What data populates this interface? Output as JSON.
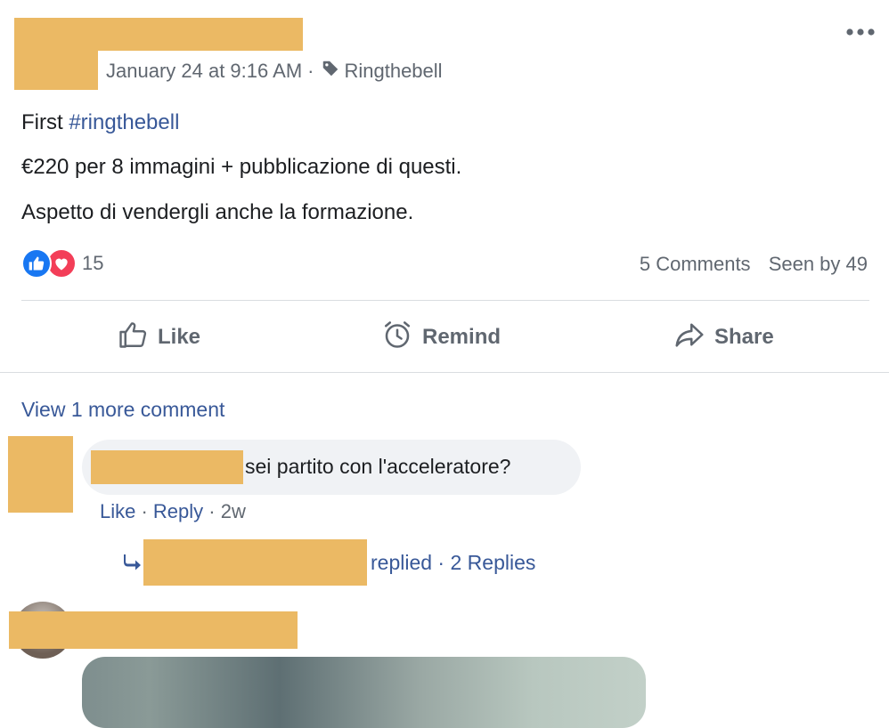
{
  "post": {
    "timestamp": "January 24 at 9:16 AM",
    "separator": "·",
    "group_name": "Ringthebell",
    "text_first": "First ",
    "hashtag": "#ringthebell",
    "text_line2": "€220 per 8 immagini + pubblicazione di questi.",
    "text_line3": "Aspetto di vendergli anche la formazione."
  },
  "reactions": {
    "count": "15",
    "icons": [
      "like-icon",
      "love-icon"
    ]
  },
  "stats": {
    "comments": "5 Comments",
    "seen_by": "Seen by 49"
  },
  "actions": {
    "like": "Like",
    "remind": "Remind",
    "share": "Share"
  },
  "comments": {
    "view_more": "View 1 more comment",
    "first": {
      "text": "sei partito con l'acceleratore?",
      "like": "Like",
      "dot1": " · ",
      "reply": "Reply",
      "dot2": " · ",
      "time": "2w"
    },
    "replies": {
      "replied": "replied",
      "dot": " · ",
      "count": "2 Replies"
    }
  },
  "colors": {
    "link": "#385898",
    "muted": "#606770",
    "like_blue": "#1877f2",
    "love_red": "#f33e58",
    "redaction": "#ebb964"
  }
}
